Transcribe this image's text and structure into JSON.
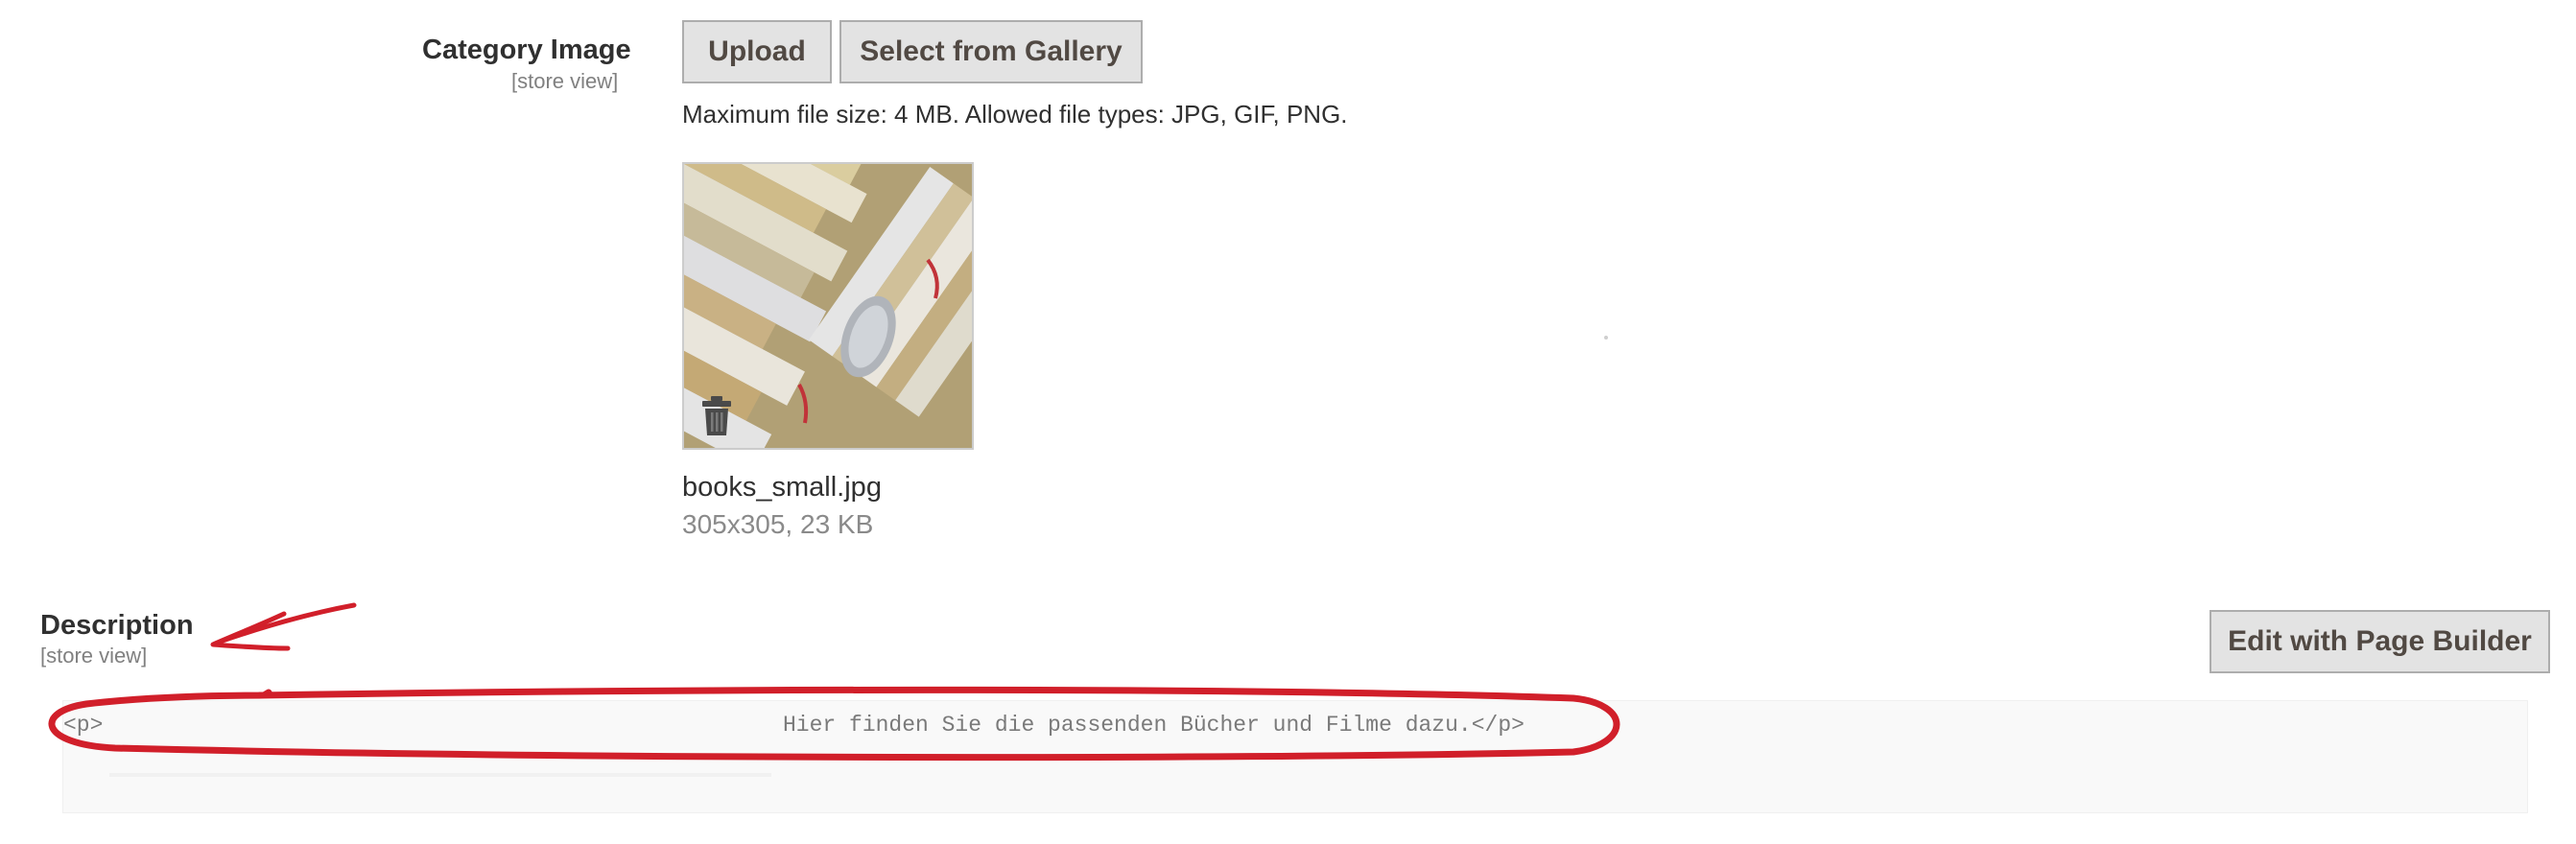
{
  "category_image": {
    "label": "Category Image",
    "scope": "[store view]",
    "upload_button": "Upload",
    "gallery_button": "Select from Gallery",
    "note": "Maximum file size: 4 MB. Allowed file types: JPG, GIF, PNG.",
    "file": {
      "name": "books_small.jpg",
      "meta": "305x305, 23 KB"
    }
  },
  "description": {
    "label": "Description",
    "scope": "[store view]",
    "page_builder_button": "Edit with Page Builder",
    "content_open": "<p>",
    "content_text": "Hier finden Sie die passenden Bücher und Filme dazu.</p>"
  },
  "colors": {
    "annotation": "#d11f2a",
    "button_bg": "#e3e3e3",
    "button_border": "#adadad"
  },
  "icons": {
    "delete": "trash-icon"
  }
}
